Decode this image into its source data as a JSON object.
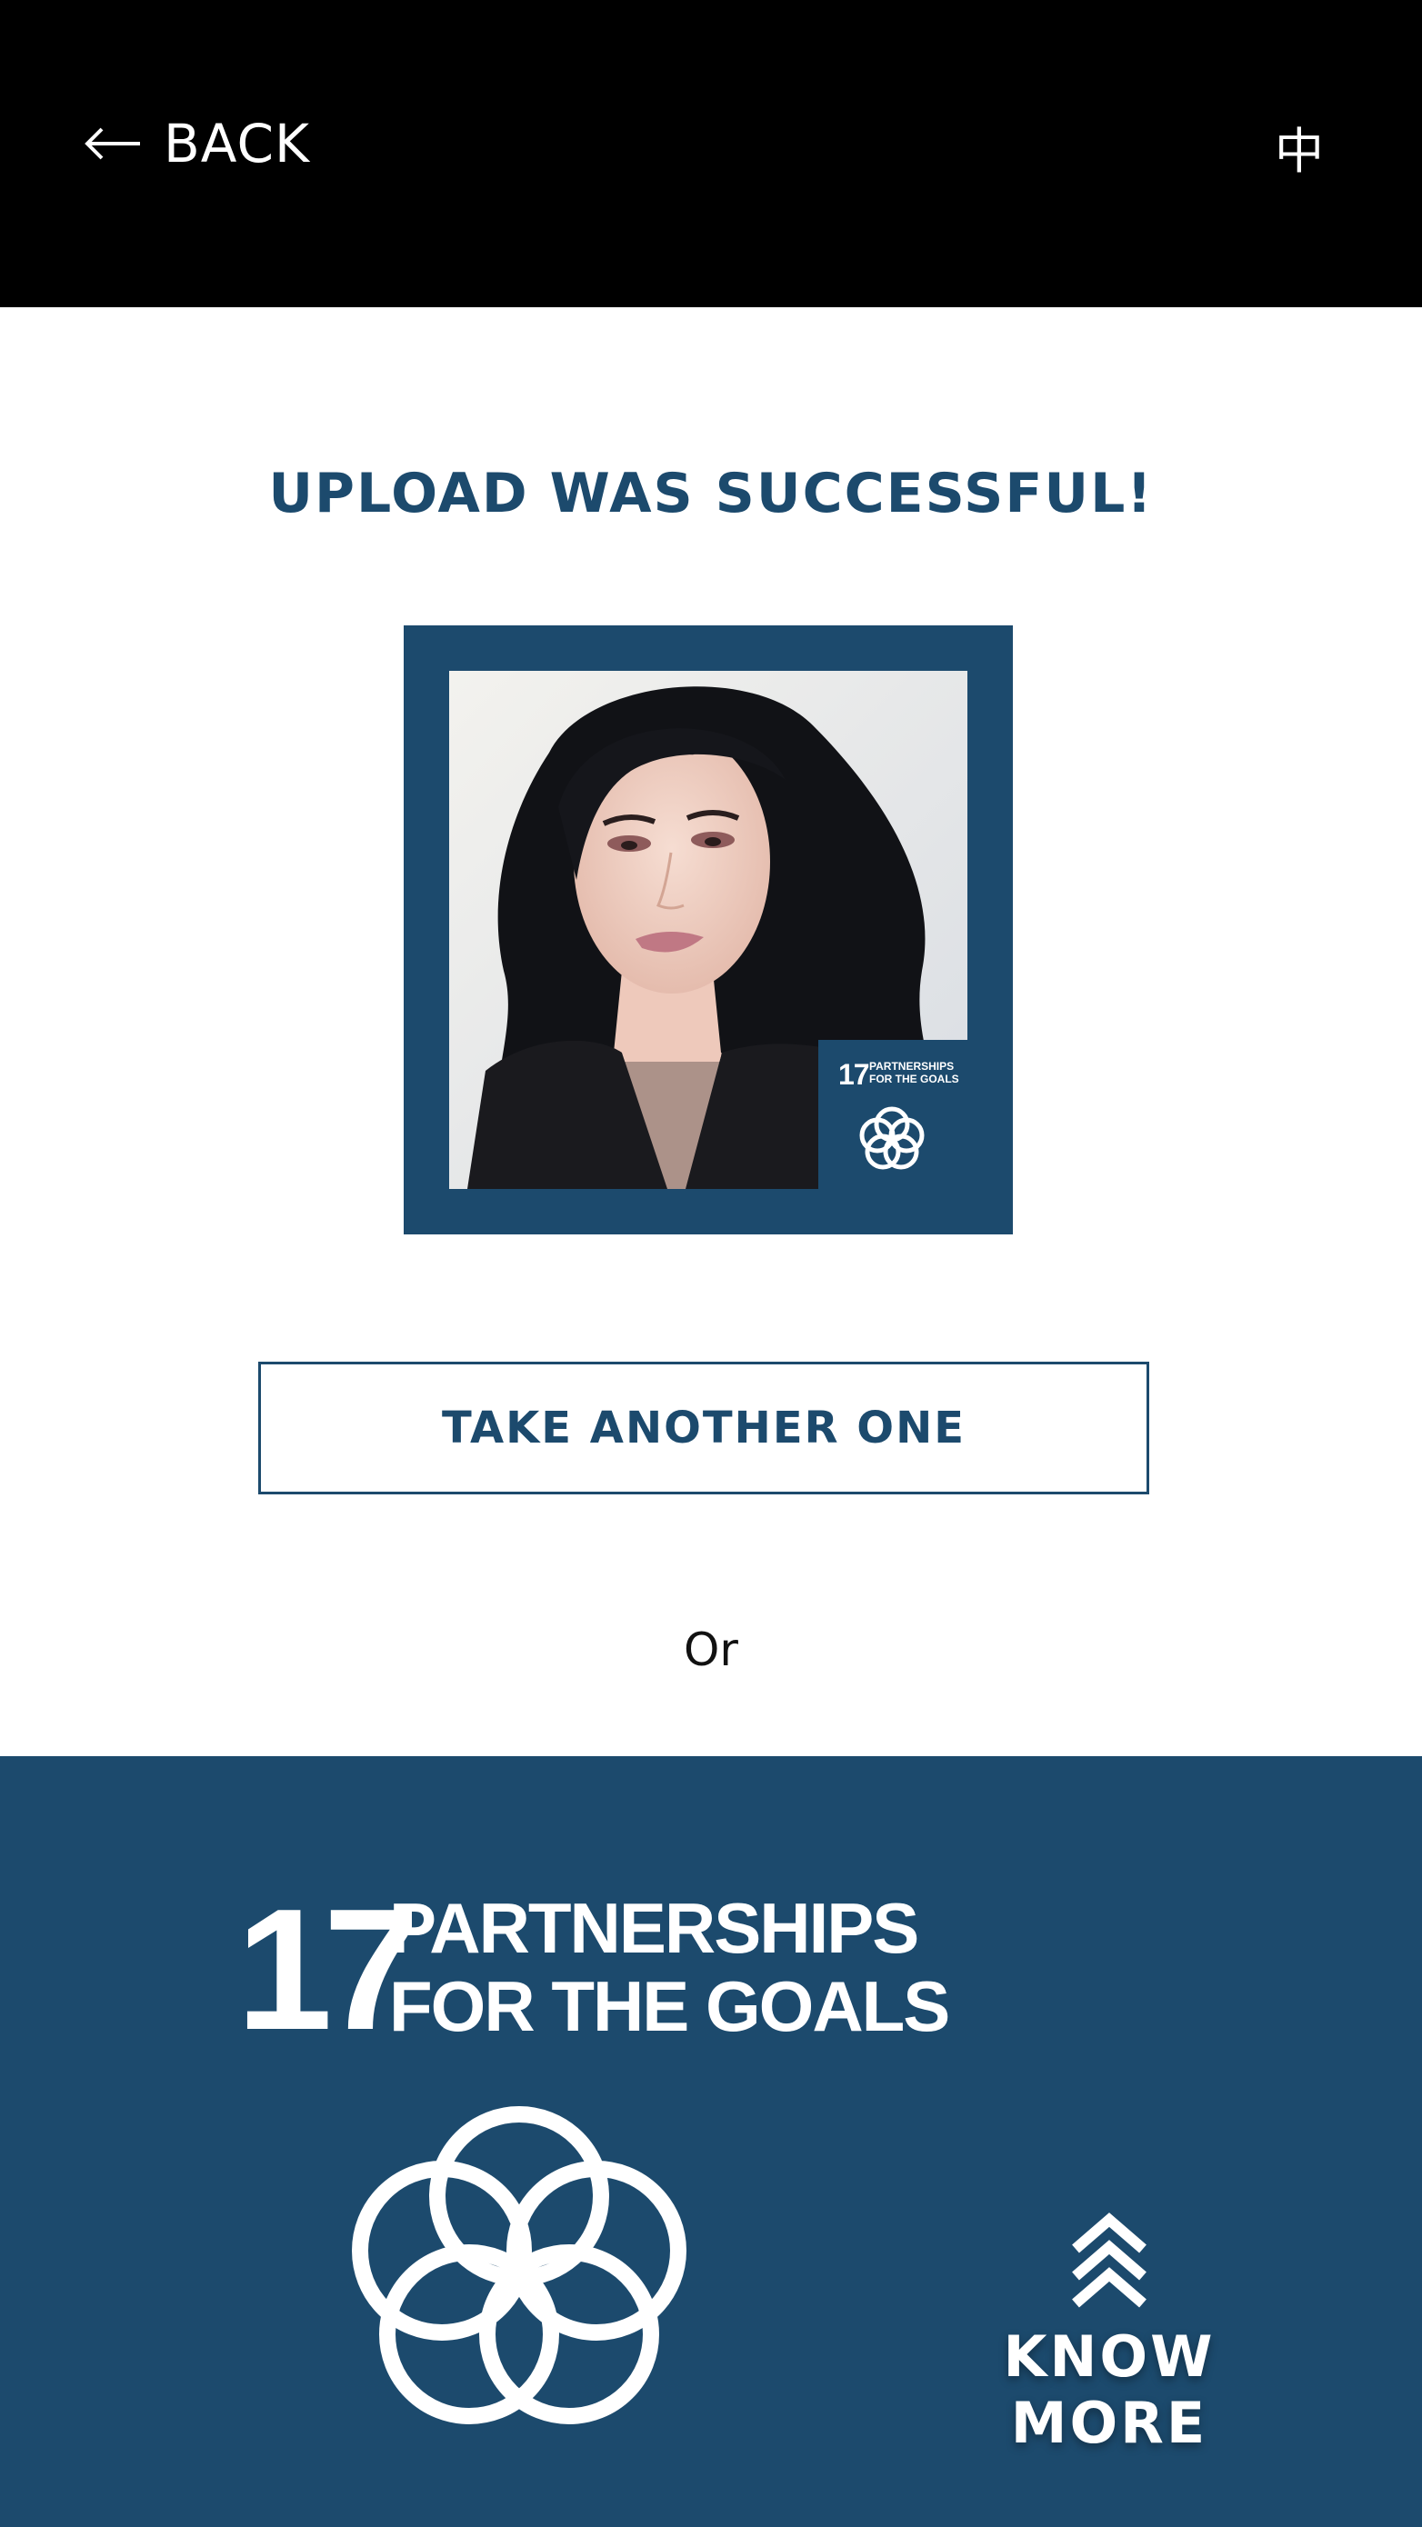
{
  "header": {
    "back_label": "BACK",
    "back_icon": "arrow-left-icon",
    "language_toggle": "中"
  },
  "main": {
    "title": "UPLOAD WAS SUCCESSFUL!",
    "photo": {
      "badge_number": "17",
      "badge_text": "PARTNERSHIPS\nFOR THE GOALS",
      "badge_icon": "interlocking-rings-icon"
    },
    "take_another_label": "TAKE ANOTHER ONE",
    "or_label": "Or"
  },
  "sdg_panel": {
    "number": "17",
    "title_line1": "PARTNERSHIPS",
    "title_line2": "FOR THE GOALS",
    "icon": "interlocking-rings-icon",
    "know_more_label": "KNOW MORE",
    "know_more_icon": "double-chevron-up-icon"
  },
  "colors": {
    "header_bg": "#000000",
    "brand_blue": "#1c4a6d",
    "background": "#ffffff",
    "text_on_dark": "#ffffff"
  }
}
